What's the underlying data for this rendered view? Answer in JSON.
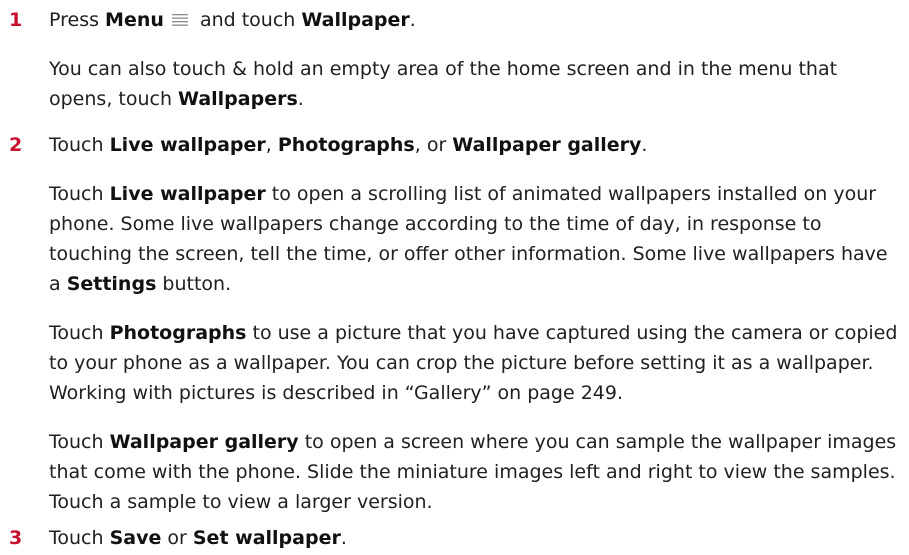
{
  "steps": [
    {
      "number": "1",
      "head": {
        "t1": "Press ",
        "b1": "Menu",
        "icon": "menu-icon",
        "t2": " and touch ",
        "b2": "Wallpaper",
        "t3": "."
      },
      "paragraphs": [
        {
          "t1": "You can also touch & hold an empty area of the home screen and in the menu that opens, touch ",
          "b1": "Wallpapers",
          "t2": "."
        }
      ]
    },
    {
      "number": "2",
      "head": {
        "t1": "Touch ",
        "b1": "Live wallpaper",
        "t2": ", ",
        "b2": "Photographs",
        "t3": ", or ",
        "b3": "Wallpaper gallery",
        "t4": "."
      },
      "paragraphs": [
        {
          "t1": "Touch ",
          "b1": "Live wallpaper",
          "t2": " to open a scrolling list of animated wallpapers installed on your phone. Some live wallpapers change according to the time of day, in response to touching the screen, tell the time, or offer other information. Some live wallpapers have a ",
          "b2": "Settings",
          "t3": " button."
        },
        {
          "t1": "Touch ",
          "b1": "Photographs",
          "t2": " to use a picture that you have captured using the camera or copied to your phone as a wallpaper. You can crop the picture before setting it as a wallpaper. Working with pictures is described in “Gallery” on page 249."
        },
        {
          "t1": "Touch ",
          "b1": "Wallpaper gallery",
          "t2": " to open a screen where you can sample the wallpaper images that come with the phone. Slide the miniature images left and right to view the samples. Touch a sample to view a larger version."
        }
      ]
    },
    {
      "number": "3",
      "head": {
        "t1": "Touch ",
        "b1": "Save",
        "t2": " or ",
        "b2": "Set wallpaper",
        "t3": "."
      },
      "paragraphs": []
    }
  ],
  "colors": {
    "step_number": "#c8102e",
    "text": "#202020"
  }
}
